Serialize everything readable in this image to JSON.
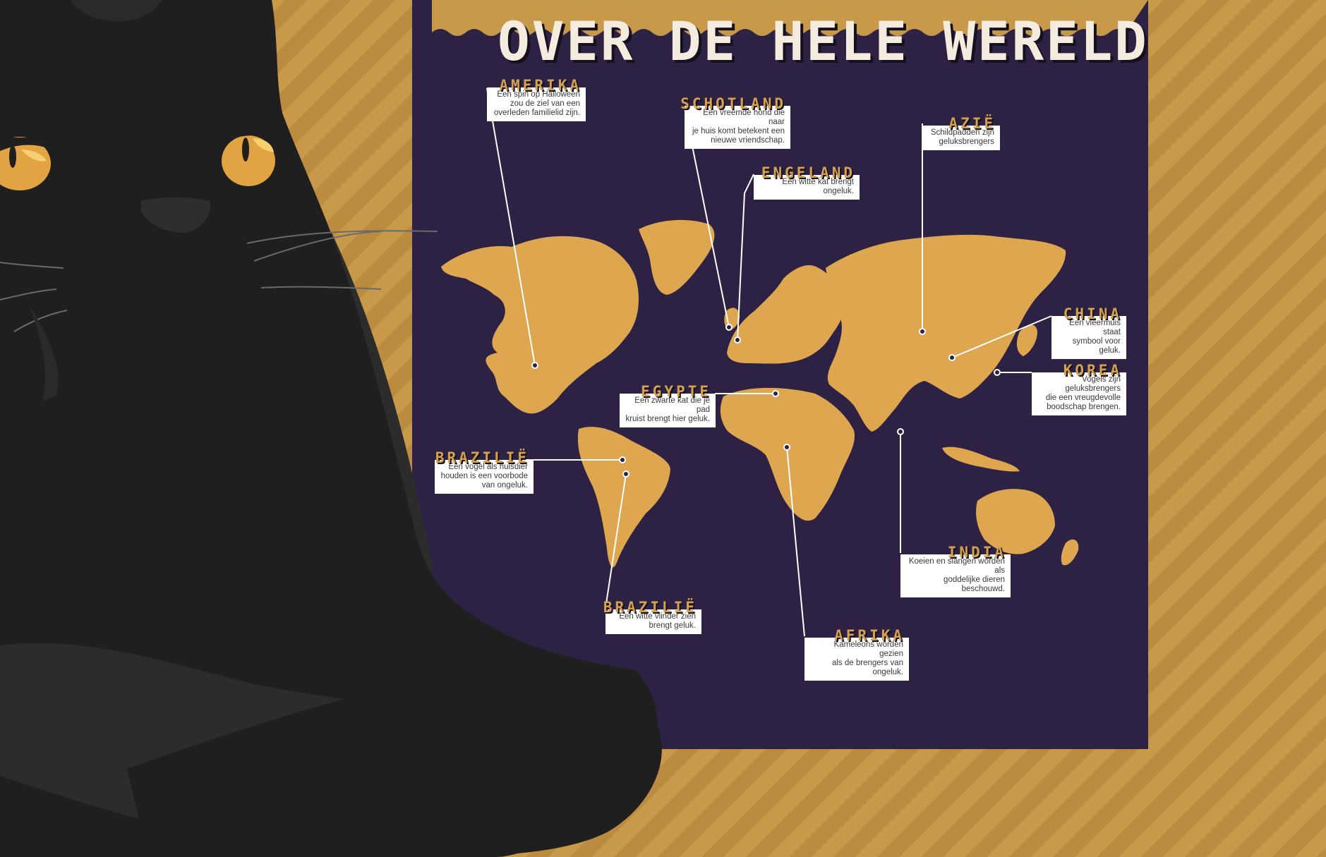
{
  "title": "OVER DE HELE WERELD",
  "colors": {
    "background": "#c9994a",
    "poster": "#2e2244",
    "continents": "#dda64f",
    "cat": "#1f1f1f",
    "cat_eye": "#e2a342",
    "label_bg": "#ffffff",
    "label_head": "#d4a14f"
  },
  "labels": [
    {
      "heading": "AMERIKA",
      "description": "Een spin op Halloween\nzou de ziel van een\noverleden familielid zijn."
    },
    {
      "heading": "SCHOTLAND",
      "description": "Een vreemde hond die naar\nje huis komt betekent een\nnieuwe vriendschap."
    },
    {
      "heading": "AZIË",
      "description": "Schildpadden zijn\ngeluksbrengers"
    },
    {
      "heading": "ENGELAND",
      "description": "Een witte kat brengt\nongeluk."
    },
    {
      "heading": "CHINA",
      "description": "Een vleermuis staat\nsymbool voor geluk."
    },
    {
      "heading": "KOREA",
      "description": "Vogels zijn geluksbrengers\ndie een vreugdevolle\nboodschap brengen."
    },
    {
      "heading": "EGYPTE",
      "description": "Een zwarte kat die je pad\nkruist brengt hier geluk."
    },
    {
      "heading": "BRAZILIË",
      "description": "Een vogel als huisdier\nhouden is een voorbode\nvan ongeluk."
    },
    {
      "heading": "INDIA",
      "description": "Koeien en slangen worden als\ngoddelijke dieren beschouwd."
    },
    {
      "heading": "BRAZILIË",
      "description": "Een witte vlinder zien\nbrengt geluk."
    },
    {
      "heading": "AFRIKA",
      "description": "Kameleons worden gezien\nals de brengers van ongeluk."
    }
  ]
}
